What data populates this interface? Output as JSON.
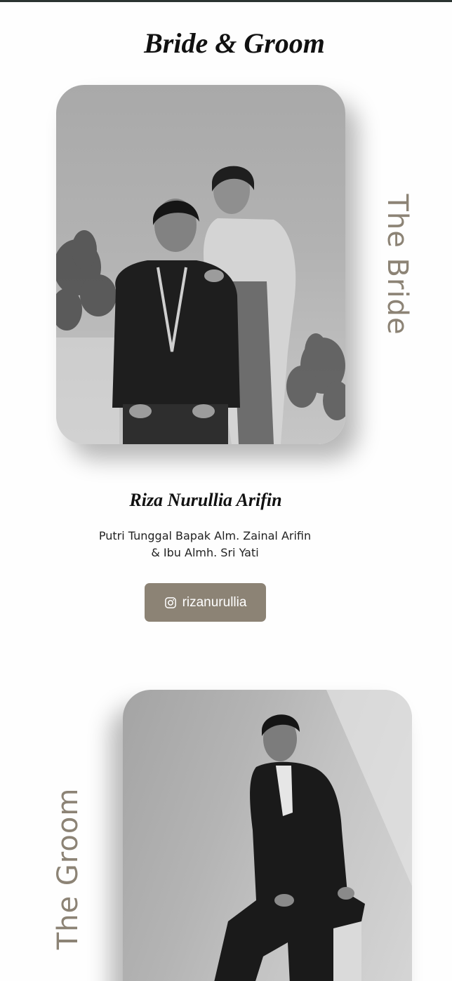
{
  "section": {
    "title": "Bride & Groom"
  },
  "bride": {
    "side_label": "The Bride",
    "name": "Riza Nurullia Arifin",
    "parents_line1": "Putri Tunggal Bapak Alm. Zainal Arifin",
    "parents_line2": "& Ibu Almh. Sri Yati",
    "instagram_handle": "rizanurullia",
    "instagram_icon": "instagram-icon",
    "photo_description": "couple-portrait-photo"
  },
  "groom": {
    "side_label": "The Groom",
    "photo_description": "groom-portrait-photo"
  },
  "colors": {
    "accent": "#8c8375",
    "top_border": "#2b3431",
    "text": "#111111"
  }
}
